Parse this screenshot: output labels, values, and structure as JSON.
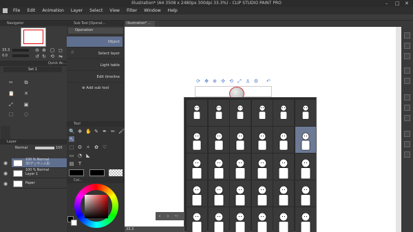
{
  "window": {
    "title": "Illustration* (A4 3508 x 2480px 300dpi 33.3%) - CLIP STUDIO PAINT PRO",
    "min": "–",
    "max": "□",
    "close": "✕"
  },
  "menu": [
    "File",
    "Edit",
    "Animation",
    "Layer",
    "Select",
    "View",
    "Filter",
    "Window",
    "Help"
  ],
  "navigator": {
    "header": "Navigator",
    "zoom": "33.3",
    "angle": "0.0"
  },
  "quick_access": {
    "header": "Quick Ac...",
    "set_label": "Set 1"
  },
  "sub_tool": {
    "header": "Sub Tool [Operat...",
    "group": "Operation",
    "items": [
      "Object",
      "Select layer",
      "Light table",
      "Edit timeline"
    ],
    "add": "Add sub tool"
  },
  "tool_panel": {
    "header": "Tool"
  },
  "canvas_tab": {
    "label": "Illustration* ..."
  },
  "layers": {
    "header": "Layer",
    "blend_mode": "Normal",
    "opacity": "100",
    "rows": [
      {
        "line1": "100 % Normal",
        "line2": "3Dデッサン人形"
      },
      {
        "line1": "100 % Normal",
        "line2": "Layer 1"
      },
      {
        "line1": "",
        "line2": "Paper"
      }
    ]
  },
  "color": {
    "header": "Col...",
    "fg_color": "#000000",
    "bg_color": "#ffffff",
    "accent": "#4a78c8"
  },
  "status": {
    "zoom": "33.3"
  },
  "object_toolbar": {
    "icons": [
      "camera-rotate-icon",
      "camera-pan-icon",
      "camera-zoom-icon",
      "move-object-icon",
      "rotate-object-icon",
      "scale-object-icon",
      "pose-icon",
      "undo-icon"
    ]
  },
  "pose_grid": {
    "rows": 5,
    "cols": 6,
    "selected_index": 11
  }
}
